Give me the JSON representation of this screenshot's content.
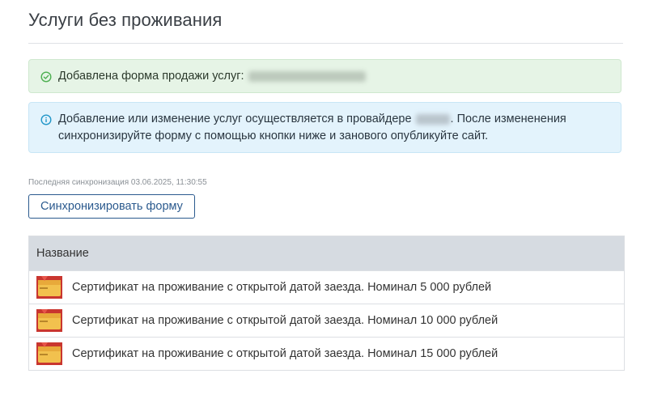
{
  "page": {
    "title": "Услуги без проживания"
  },
  "alerts": {
    "success": {
      "text": "Добавлена форма продажи услуг:"
    },
    "info": {
      "text_part1": "Добавление или изменение услуг осуществляется в провайдере",
      "text_part2": ". После измененения синхронизируйте форму с помощью кнопки ниже и занового опубликуйте сайт."
    }
  },
  "sync": {
    "last_sync": "Последняя синхронизация 03.06.2025, 11:30:55",
    "button_label": "Синхронизировать форму"
  },
  "table": {
    "header": "Название",
    "rows": [
      {
        "name": "Сертификат на проживание с открытой датой заезда. Номинал 5 000 рублей"
      },
      {
        "name": "Сертификат на проживание с открытой датой заезда. Номинал 10 000 рублей"
      },
      {
        "name": "Сертификат на проживание с открытой датой заезда. Номинал 15 000 рублей"
      }
    ]
  },
  "colors": {
    "success_icon": "#4caf50",
    "info_icon": "#2196c8",
    "button_accent": "#2b5a8e"
  },
  "icons": {
    "success": "check-circle-icon",
    "info": "info-circle-icon",
    "thumbnail": "gift-card-icon"
  }
}
